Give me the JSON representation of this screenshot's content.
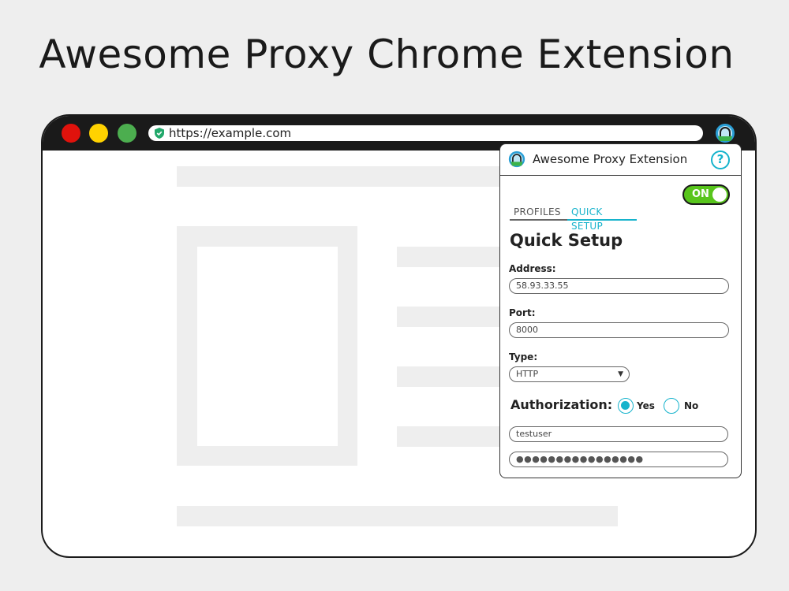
{
  "headline": "Awesome Proxy Chrome Extension",
  "browser": {
    "url": "https://example.com",
    "icons": [
      "secure-shield-icon",
      "proxy-extension-icon"
    ]
  },
  "popup": {
    "title": "Awesome Proxy Extension",
    "help_symbol": "?",
    "toggle_label": "ON",
    "tabs": [
      {
        "label": "PROFILES",
        "active": false
      },
      {
        "label": "QUICK SETUP",
        "active": true
      }
    ],
    "section_title": "Quick Setup",
    "address_label": "Address:",
    "address_value": "58.93.33.55",
    "port_label": "Port:",
    "port_value": "8000",
    "type_label": "Type:",
    "type_value": "HTTP",
    "authorization_label": "Authorization:",
    "auth_options": [
      {
        "label": "Yes",
        "selected": true
      },
      {
        "label": "No",
        "selected": false
      }
    ],
    "username_value": "testuser",
    "password_masked": "●●●●●●●●●●●●●●●●"
  },
  "colors": {
    "accent": "#16b3cc",
    "toggle_on": "#58c51c",
    "close_dot": "#e0120c",
    "minimize_dot": "#ffd200",
    "maximize_dot": "#4cae4f"
  }
}
